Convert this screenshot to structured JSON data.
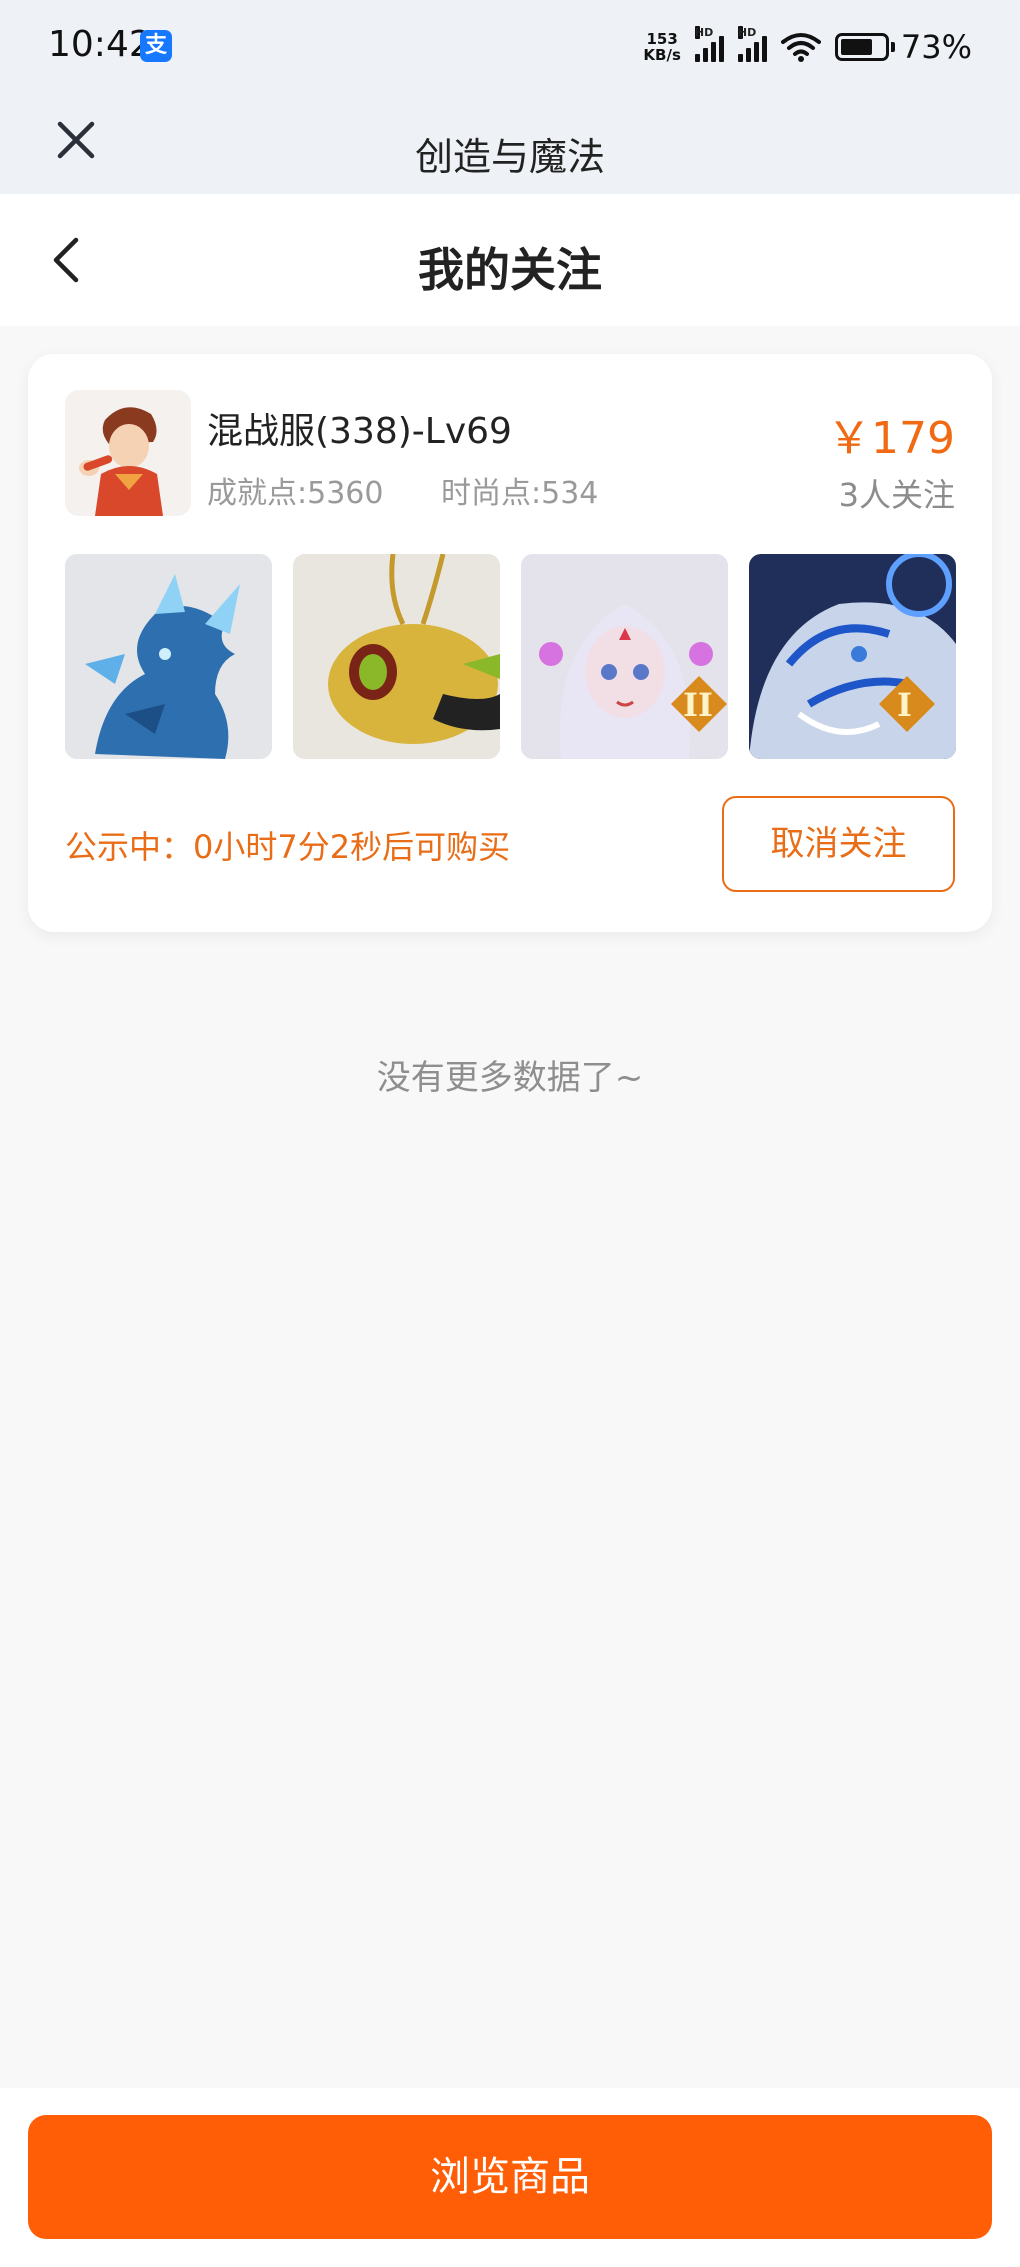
{
  "status_bar": {
    "time": "10:42",
    "app_badge": "支",
    "net_speed_top": "153",
    "net_speed_bottom": "KB/s",
    "signal_label": "HD",
    "battery": "73%",
    "battery_level": 0.73
  },
  "app_header": {
    "title": "创造与魔法"
  },
  "page_nav": {
    "title": "我的关注"
  },
  "card": {
    "role_name": "混战服(338)-Lv69",
    "achievement": "成就点:5360",
    "fashion": "时尚点:534",
    "price": "￥179",
    "followers": "3人关注",
    "public_status": "公示中：0小时7分2秒后可购买",
    "unfollow_label": "取消关注",
    "pets": [
      {
        "name": "ice-dragon",
        "badge": ""
      },
      {
        "name": "golden-insect",
        "badge": ""
      },
      {
        "name": "white-spirit-girl",
        "badge": "II"
      },
      {
        "name": "frost-tiger",
        "badge": "I"
      }
    ]
  },
  "list_footer": "没有更多数据了~",
  "bottom": {
    "browse_label": "浏览商品"
  },
  "colors": {
    "accent": "#f06a13",
    "primary_button": "#ff5d06",
    "header_bg": "#eef2f6",
    "page_bg": "#f8f8f9"
  }
}
